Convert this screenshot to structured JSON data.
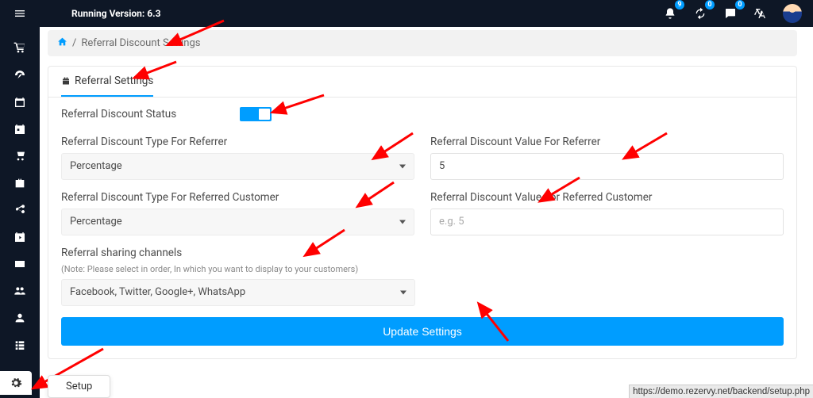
{
  "header": {
    "version_label": "Running Version: 6.3",
    "badges": {
      "bell": "9",
      "sync": "0",
      "chat": "0"
    }
  },
  "breadcrumb": {
    "sep": "/",
    "current": "Referral Discount Settings"
  },
  "tab": {
    "label": "Referral Settings"
  },
  "form": {
    "status_label": "Referral Discount Status",
    "type_referrer_label": "Referral Discount Type For Referrer",
    "type_referrer_value": "Percentage",
    "value_referrer_label": "Referral Discount Value For Referrer",
    "value_referrer_value": "5",
    "type_referred_label": "Referral Discount Type For Referred Customer",
    "type_referred_value": "Percentage",
    "value_referred_label": "Referral Discount Value For Referred Customer",
    "value_referred_placeholder": "e.g. 5",
    "channels_label": "Referral sharing channels",
    "channels_note": "(Note: Please select in order, In which you want to display to your customers)",
    "channels_value": "Facebook, Twitter, Google+, WhatsApp",
    "submit_label": "Update Settings"
  },
  "tooltip": {
    "label": "Setup"
  },
  "url_hint": "https://demo.rezervy.net/backend/setup.php"
}
